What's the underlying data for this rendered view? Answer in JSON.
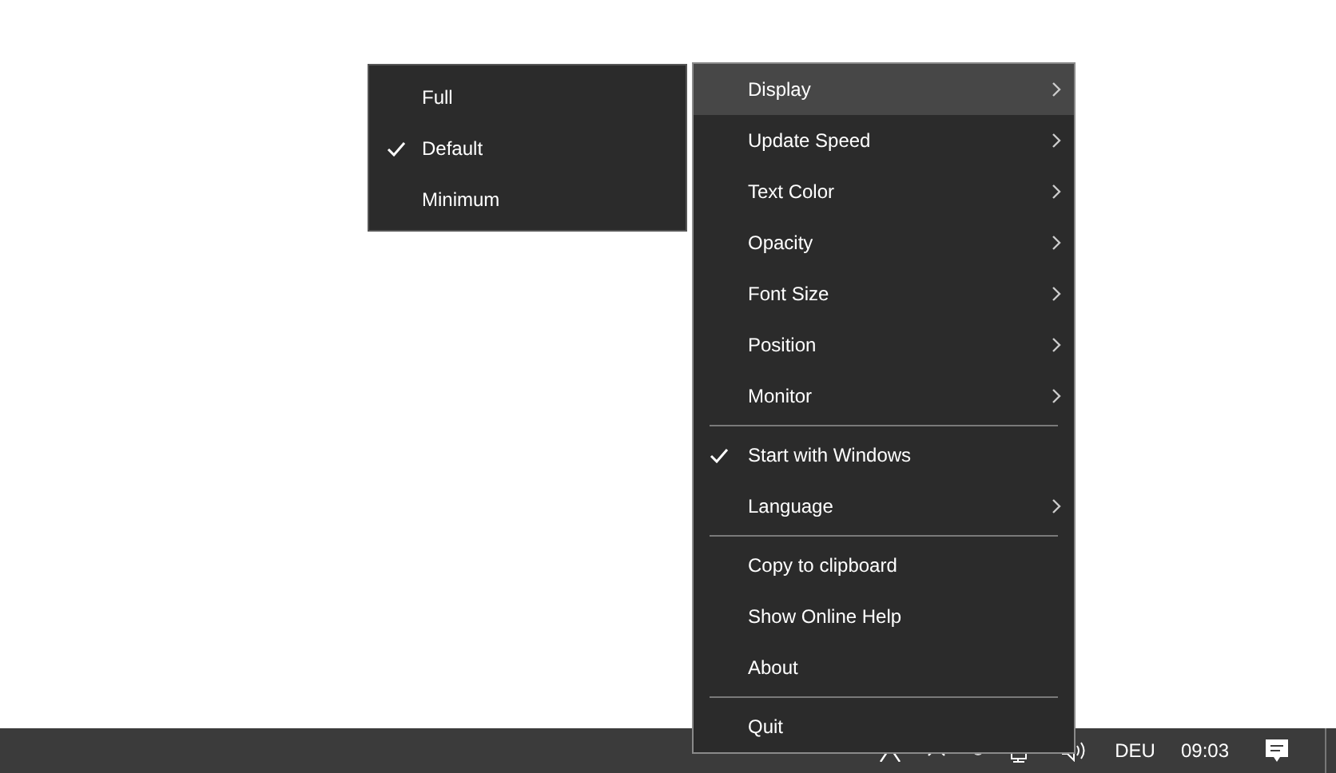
{
  "context_menu": {
    "items": [
      {
        "kind": "item",
        "label": "Display",
        "submenu": true,
        "checked": false,
        "selected": true
      },
      {
        "kind": "item",
        "label": "Update Speed",
        "submenu": true,
        "checked": false,
        "selected": false
      },
      {
        "kind": "item",
        "label": "Text Color",
        "submenu": true,
        "checked": false,
        "selected": false
      },
      {
        "kind": "item",
        "label": "Opacity",
        "submenu": true,
        "checked": false,
        "selected": false
      },
      {
        "kind": "item",
        "label": "Font Size",
        "submenu": true,
        "checked": false,
        "selected": false
      },
      {
        "kind": "item",
        "label": "Position",
        "submenu": true,
        "checked": false,
        "selected": false
      },
      {
        "kind": "item",
        "label": "Monitor",
        "submenu": true,
        "checked": false,
        "selected": false
      },
      {
        "kind": "separator"
      },
      {
        "kind": "item",
        "label": "Start with Windows",
        "submenu": false,
        "checked": true,
        "selected": false
      },
      {
        "kind": "item",
        "label": "Language",
        "submenu": true,
        "checked": false,
        "selected": false
      },
      {
        "kind": "separator"
      },
      {
        "kind": "item",
        "label": "Copy to clipboard",
        "submenu": false,
        "checked": false,
        "selected": false
      },
      {
        "kind": "item",
        "label": "Show Online Help",
        "submenu": false,
        "checked": false,
        "selected": false
      },
      {
        "kind": "item",
        "label": "About",
        "submenu": false,
        "checked": false,
        "selected": false
      },
      {
        "kind": "separator"
      },
      {
        "kind": "item",
        "label": "Quit",
        "submenu": false,
        "checked": false,
        "selected": false
      }
    ]
  },
  "submenu": {
    "items": [
      {
        "label": "Full",
        "checked": false
      },
      {
        "label": "Default",
        "checked": true
      },
      {
        "label": "Minimum",
        "checked": false
      }
    ]
  },
  "taskbar": {
    "language": "DEU",
    "clock": "09:03"
  }
}
